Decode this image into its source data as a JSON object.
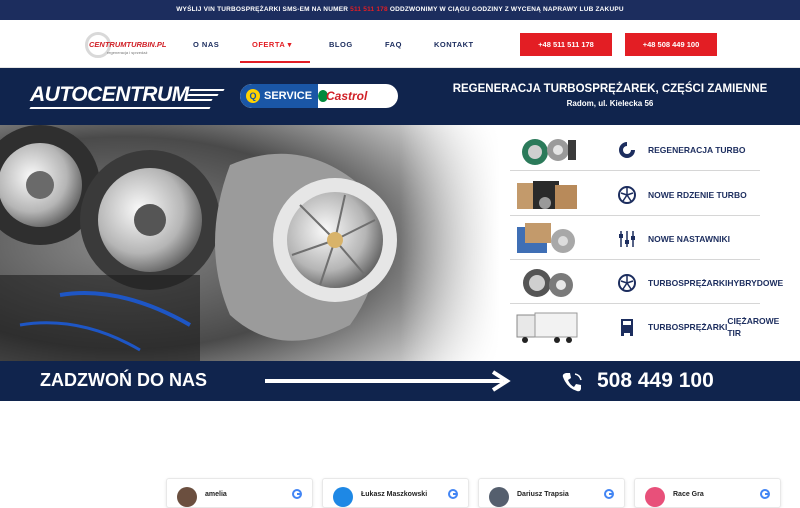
{
  "topbar": {
    "prefix": "WYŚLIJ VIN TURBOSPRĘŻARKI SMS-EM NA NUMER",
    "number": "511 511 178",
    "suffix": "ODDZWONIMY W CIĄGU GODZINY Z WYCENĄ NAPRAWY LUB ZAKUPU"
  },
  "logo": {
    "brand": "CENTRUMTURBIN.PL",
    "tagline": "regeneracja i sprzedaż"
  },
  "nav": {
    "items": [
      {
        "label": "O NAS"
      },
      {
        "label": "OFERTA ▾"
      },
      {
        "label": "BLOG"
      },
      {
        "label": "FAQ"
      },
      {
        "label": "KONTAKT"
      }
    ],
    "phone1": "+48 511 511 178",
    "phone2": "+48 508 449 100"
  },
  "banner": {
    "autocentrum": "AUTOCENTRUM",
    "qservice": "SERVICE",
    "q": "Q",
    "castrol": "Castrol",
    "title": "REGENERACJA TURBOSPRĘŻAREK, CZĘŚCI ZAMIENNE",
    "address": "Radom, ul. Kielecka 56"
  },
  "services": [
    {
      "label": "REGENERACJA TURBO",
      "icon": "turbo-snail-icon"
    },
    {
      "label": "NOWE RDZENIE TURBO",
      "icon": "compressor-wheel-icon"
    },
    {
      "label": "NOWE NASTAWNIKI",
      "icon": "sliders-icon"
    },
    {
      "label": "TURBOSPRĘŻARKI",
      "label2": "HYBRYDOWE",
      "icon": "compressor-wheel-icon"
    },
    {
      "label": "TURBOSPRĘŻARKI",
      "label2": "CIĘŻAROWE TIR",
      "icon": "truck-icon"
    }
  ],
  "callbar": {
    "cta": "ZADZWOŃ DO NAS",
    "number": "508 449 100"
  },
  "reviews": [
    {
      "name": "amelia",
      "avatar_color": "#6b4f3f"
    },
    {
      "name": "Łukasz Maszkowski",
      "avatar_color": "#1e88e5"
    },
    {
      "name": "Dariusz Trapsia",
      "avatar_color": "#555f6e"
    },
    {
      "name": "Race Gra",
      "avatar_color": "#e8507a"
    }
  ],
  "colors": {
    "navy": "#10244d",
    "red": "#e31e24",
    "menu": "#1c2d5e"
  }
}
